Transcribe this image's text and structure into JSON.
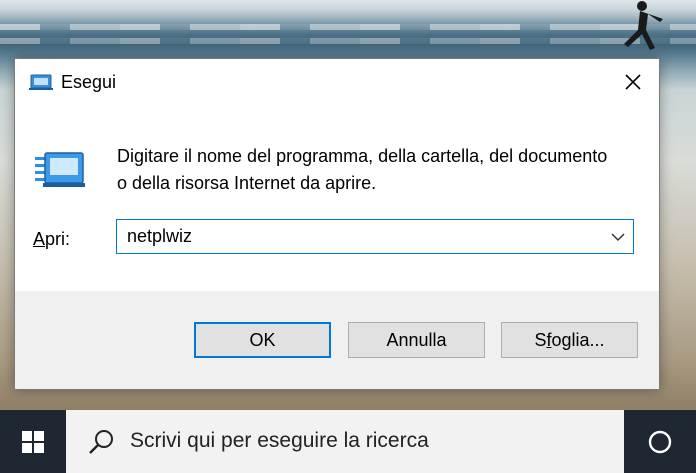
{
  "dialog": {
    "title": "Esegui",
    "description": "Digitare il nome del programma, della cartella, del documento o della risorsa Internet da aprire.",
    "open_label_accel": "A",
    "open_label_rest": "pri:",
    "open_value": "netplwiz",
    "buttons": {
      "ok": "OK",
      "cancel": "Annulla",
      "browse_pre": "S",
      "browse_accel": "f",
      "browse_post": "oglia..."
    }
  },
  "taskbar": {
    "search_placeholder": "Scrivi qui per eseguire la ricerca"
  },
  "icons": {
    "start": "windows-logo-icon",
    "search": "search-icon",
    "cortana": "cortana-circle-icon",
    "run": "run-icon",
    "close": "close-icon",
    "dropdown": "chevron-down-icon"
  },
  "colors": {
    "accent": "#0078d7",
    "taskbar": "#1f2733",
    "footer": "#f0f0f0"
  }
}
